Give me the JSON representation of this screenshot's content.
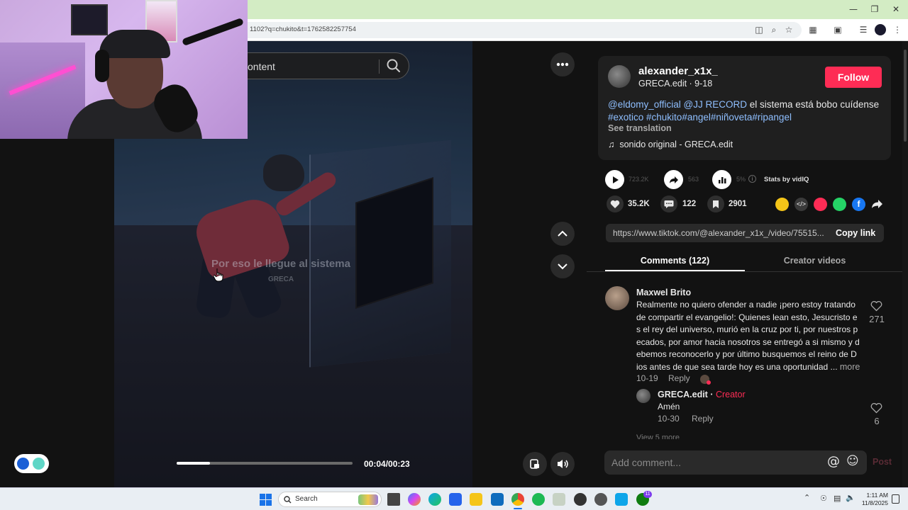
{
  "browser": {
    "url": "1102?q=chukito&t=1762582257754"
  },
  "search": {
    "value": "ontent"
  },
  "video": {
    "subtitle": "Por eso le llegue al sistema",
    "watermark": "GRECA",
    "time": "00:04/00:23",
    "progress": 0.19
  },
  "post": {
    "author": "alexander_x1x_",
    "author_sub": "GRECA.edit · 9-18",
    "follow_label": "Follow",
    "mention1": "@eldomy_official",
    "mention2": "@JJ RECORD",
    "desc_text": " el sistema está bobo cuídense",
    "hashtags": "#exotico #chukito#angel#niñoveta#ripangel",
    "see_translation": "See translation",
    "sound": "sonido original - GRECA.edit",
    "views": "723.2K",
    "shares_top": "563",
    "vidiq_pct": "5%",
    "stats_by": "Stats by vidIQ",
    "likes": "35.2K",
    "comments_count": "122",
    "saves": "2901",
    "link": "https://www.tiktok.com/@alexander_x1x_/video/75515...",
    "copy_label": "Copy link"
  },
  "tabs": [
    {
      "label": "Comments (122)"
    },
    {
      "label": "Creator videos"
    }
  ],
  "comments": [
    {
      "name": "Maxwel Brito",
      "lines": [
        "Realmente no quiero ofender a nadie ¡pero estoy tratando",
        "de compartir el evangelio!: Quienes lean esto, Jesucristo e",
        "s el rey del universo, murió en la cruz por ti, por nuestros p",
        "ecados, por amor hacia nosotros se entregó a si mismo y d",
        "ebemos reconocerlo y por último busquemos el reino de D",
        "ios antes de que sea tarde hoy es una oportunidad ..."
      ],
      "more": "more",
      "date": "10-19",
      "reply": "Reply",
      "likes": "271"
    }
  ],
  "reply": {
    "name": "GRECA.edit",
    "sep": " · ",
    "badge": "Creator",
    "text": "Amén",
    "date": "10-30",
    "reply": "Reply",
    "likes": "6"
  },
  "view_more": "View 5 more",
  "comment_input": {
    "placeholder": "Add comment...",
    "post": "Post"
  },
  "taskbar": {
    "search": "Search",
    "time": "1:11 AM",
    "date": "11/8/2025",
    "badge": "11"
  }
}
